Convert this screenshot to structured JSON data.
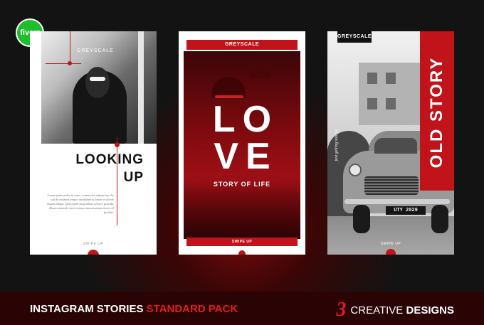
{
  "badge": {
    "text": "fiverr"
  },
  "card1": {
    "label": "GREYSCALE",
    "title_line1": "LOOKING",
    "title_line2": "UP",
    "body": "Lorem ipsum dolor sit amet, consectetur adipiscing elit, sed do eiusmod tempor incididunt ut labore et dolore magna aliqua. Quis ipsum suspendisse ultrices gravida. Risus commodo viverra maecenas accumsan lacus vel facilisis.",
    "swipe": "SWIPE UP"
  },
  "card2": {
    "label": "GREYSCALE",
    "title_line1": "LO",
    "title_line2": "VE",
    "subtitle": "STORY OF LIFE",
    "swipe": "SWIPE UP"
  },
  "card3": {
    "label": "GREYSCALE",
    "title": "OLD STORY",
    "tagline": "just getting started",
    "plate": "UTY 2029",
    "swipe": "SWIPE UP"
  },
  "footer": {
    "left_prefix": "INSTAGRAM STORIES ",
    "left_highlight": "STANDARD PACK",
    "right_number": "3",
    "right_text": "CREATIVE ",
    "right_bold": "DESIGNS"
  },
  "colors": {
    "accent": "#c0141a",
    "badge": "#1dbf2d",
    "background": "#131313"
  }
}
